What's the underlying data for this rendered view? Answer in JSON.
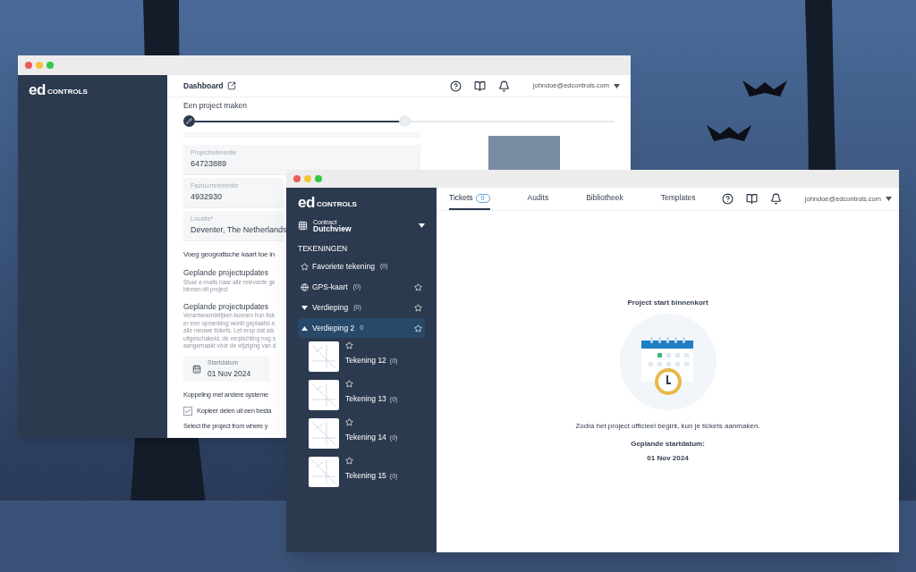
{
  "back_window": {
    "logo": {
      "mark": "ed",
      "word": "CONTROLS"
    },
    "header": {
      "title": "Dashboard",
      "user": "johndoe@edcontrols.com"
    },
    "heading": "Een project maken",
    "stepper": {
      "level": 0.5
    },
    "fields": [
      {
        "label": "Projectreferentie",
        "value": "64723889"
      },
      {
        "label": "Factuurreferentie",
        "value": "4932930"
      },
      {
        "label": "Locatie*",
        "value": "Deventer, The Netherlands"
      }
    ],
    "map_option": "Voeg geografische kaart toe in",
    "sections": [
      {
        "title": "Geplande projectupdates",
        "lines": [
          "Stuur e-mails naar alle relevante ge",
          "binnen dit project"
        ]
      },
      {
        "title": "Geplande projectupdates",
        "lines": [
          "Verantwoordelijken kunnen hun tick",
          "er een opmerking wordt geplaatst a",
          "alle nieuwe tickets. Let erop dat als",
          "uitgeschakeld, de verplichting nog s",
          "aangemaakt vóór de wijziging van d"
        ]
      }
    ],
    "start_date": {
      "label": "Startdatum",
      "value": "01 Nov 2024"
    },
    "integration": "Koppeling met andere systeme",
    "copy_option": {
      "label": "Kopieer delen uit een besta",
      "checked": true
    },
    "select_hint": "Select the project from where y"
  },
  "front_window": {
    "logo": {
      "mark": "ed",
      "word": "CONTROLS"
    },
    "contract": {
      "label": "Contract",
      "value": "Dutchview"
    },
    "section_title": "TEKENINGEN",
    "tree": [
      {
        "kind": "favorite",
        "label": "Favoriete tekening",
        "count": "(0)",
        "selected": false
      },
      {
        "kind": "gps",
        "label": "GPS-kaart",
        "count": "(0)",
        "selected": false
      },
      {
        "kind": "folder",
        "label": "Verdieping",
        "count": "(0)",
        "expanded": false,
        "selected": false
      },
      {
        "kind": "folder",
        "label": "Verdieping 2",
        "count": "0",
        "expanded": true,
        "selected": true,
        "children": [
          {
            "label": "Tekening 12",
            "count": "(0)"
          },
          {
            "label": "Tekening 13",
            "count": "(0)"
          },
          {
            "label": "Tekening 14",
            "count": "(0)"
          },
          {
            "label": "Tekening 15",
            "count": "(0)"
          }
        ]
      }
    ],
    "tabs": [
      {
        "label": "Tickets",
        "badge": "0",
        "selected": true
      },
      {
        "label": "Audits",
        "selected": false
      },
      {
        "label": "Bibliotheek",
        "selected": false
      },
      {
        "label": "Templates",
        "selected": false
      }
    ],
    "user": "johndoe@edcontrols.com",
    "empty_state": {
      "title": "Project start binnenkort",
      "message": "Zodra het project officieel begint, kun je tickets aanmaken.",
      "date_label": "Geplande startdatum:",
      "date": "01 Nov 2024"
    }
  }
}
